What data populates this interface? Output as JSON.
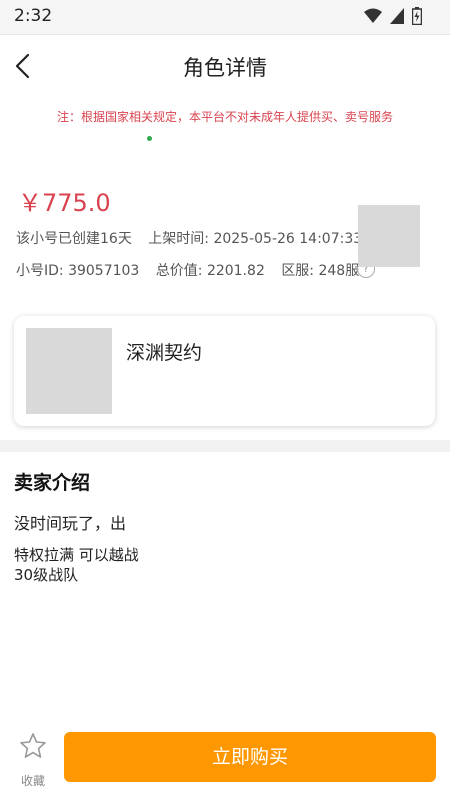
{
  "status_bar": {
    "time": "2:32"
  },
  "header": {
    "title": "角色详情"
  },
  "notice": "注：根据国家相关规定，本平台不对未成年人提供买、卖号服务",
  "listing": {
    "price": "￥775.0",
    "created": "该小号已创建16天",
    "listed_time": "上架时间: 2025-05-26 14:07:33",
    "account_id": "小号ID: 39057103",
    "total_value": "总价值: 2201.82",
    "server": "区服: 248服"
  },
  "game_card": {
    "name": "深渊契约"
  },
  "seller": {
    "section_title": "卖家介绍",
    "line1": "没时间玩了，出",
    "line2": "特权拉满   可以越战",
    "line3": "30级战队"
  },
  "bottom": {
    "favorite_label": "收藏",
    "buy_label": "立即购买"
  },
  "colors": {
    "accent": "#ff9800",
    "price": "#d9434f"
  }
}
